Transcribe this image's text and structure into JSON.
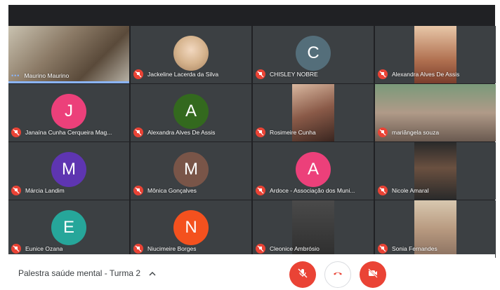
{
  "meeting": {
    "title": "Palestra saúde mental - Turma 2"
  },
  "participants": [
    {
      "name": "Maurino Maurino",
      "initial": "",
      "color": "",
      "type": "video",
      "speaking": true
    },
    {
      "name": "Jackeline Lacerda da Silva",
      "initial": "",
      "color": "",
      "type": "photo",
      "muted": true
    },
    {
      "name": "CHISLEY NOBRE",
      "initial": "C",
      "color": "#546e7a",
      "type": "avatar",
      "muted": true
    },
    {
      "name": "Alexandra Alves De Assis",
      "initial": "",
      "color": "",
      "type": "video",
      "muted": true
    },
    {
      "name": "Janaína Cunha Cerqueira Mag...",
      "initial": "J",
      "color": "#ec407a",
      "type": "avatar",
      "muted": true
    },
    {
      "name": "Alexandra Alves De Assis",
      "initial": "A",
      "color": "#33691e",
      "type": "avatar",
      "muted": true
    },
    {
      "name": "Rosimeire Cunha",
      "initial": "",
      "color": "",
      "type": "video",
      "muted": true
    },
    {
      "name": "mariângela souza",
      "initial": "",
      "color": "",
      "type": "video",
      "muted": true
    },
    {
      "name": "Márcia Landim",
      "initial": "M",
      "color": "#5e35b1",
      "type": "avatar",
      "muted": true
    },
    {
      "name": "Mônica Gonçalves",
      "initial": "M",
      "color": "#795548",
      "type": "avatar",
      "muted": true
    },
    {
      "name": "Ardoce - Associação dos Muni...",
      "initial": "A",
      "color": "#ec407a",
      "type": "avatar",
      "muted": true
    },
    {
      "name": "Nicole Amaral",
      "initial": "",
      "color": "",
      "type": "video",
      "muted": true
    },
    {
      "name": "Eunice Ozana",
      "initial": "E",
      "color": "#26a69a",
      "type": "avatar",
      "muted": true
    },
    {
      "name": "Niucimeire Borges",
      "initial": "N",
      "color": "#f4511e",
      "type": "avatar",
      "muted": true
    },
    {
      "name": "Cleonice Ambrósio",
      "initial": "",
      "color": "",
      "type": "video",
      "muted": true
    },
    {
      "name": "Sonia Fernandes",
      "initial": "",
      "color": "",
      "type": "video",
      "muted": true
    }
  ],
  "controls": {
    "mic_icon": "mic-off-icon",
    "hangup_icon": "hangup-icon",
    "camera_icon": "camera-off-icon",
    "accent_red": "#ea4335"
  }
}
